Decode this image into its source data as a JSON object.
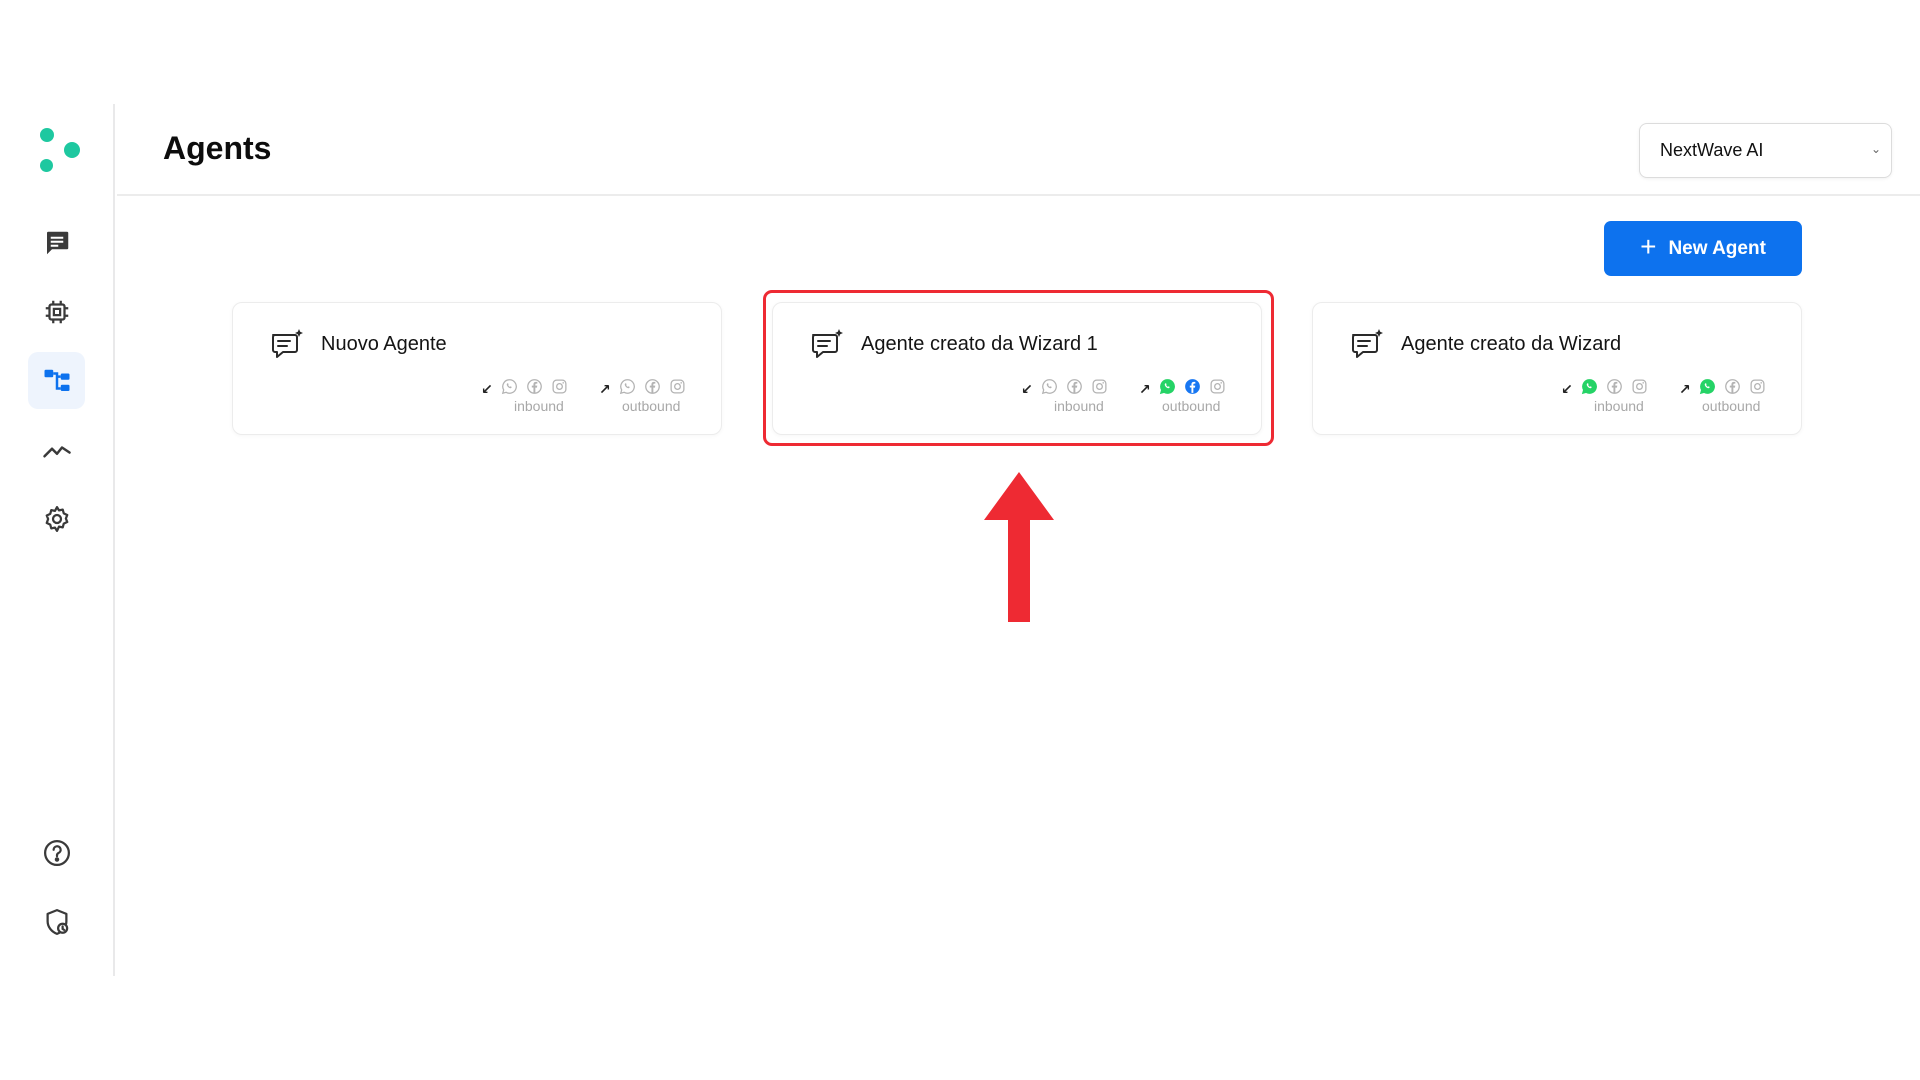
{
  "header": {
    "title": "Agents"
  },
  "org_select": {
    "value": "NextWave AI"
  },
  "actions": {
    "new_agent_label": "New Agent"
  },
  "sidebar": {
    "items": [
      {
        "icon": "chat-icon"
      },
      {
        "icon": "chip-icon"
      },
      {
        "icon": "workflow-icon",
        "active": true
      },
      {
        "icon": "analytics-icon"
      },
      {
        "icon": "gear-icon"
      },
      {
        "icon": "help-icon"
      },
      {
        "icon": "shield-icon"
      }
    ]
  },
  "agents": [
    {
      "name": "Nuovo Agente",
      "inbound_label": "inbound",
      "outbound_label": "outbound",
      "inbound": {
        "whatsapp": false,
        "facebook": false,
        "instagram": false
      },
      "outbound": {
        "whatsapp": false,
        "facebook": false,
        "instagram": false
      }
    },
    {
      "name": "Agente creato da Wizard 1",
      "inbound_label": "inbound",
      "outbound_label": "outbound",
      "inbound": {
        "whatsapp": false,
        "facebook": false,
        "instagram": false
      },
      "outbound": {
        "whatsapp": true,
        "facebook": true,
        "instagram": false
      },
      "highlighted": true
    },
    {
      "name": "Agente creato da Wizard",
      "inbound_label": "inbound",
      "outbound_label": "outbound",
      "inbound": {
        "whatsapp": true,
        "facebook": false,
        "instagram": false
      },
      "outbound": {
        "whatsapp": true,
        "facebook": false,
        "instagram": false
      }
    }
  ],
  "colors": {
    "accent": "#0d72ee",
    "brand": "#1ec8a0",
    "highlight": "#ee2a33",
    "whatsapp_active": "#25d366",
    "facebook_active": "#1877f2",
    "inactive_icon": "#9a9a9a"
  }
}
